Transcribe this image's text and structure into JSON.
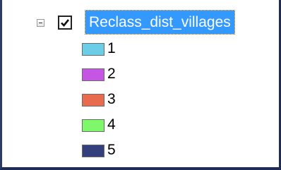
{
  "toc": {
    "layer": {
      "name": "Reclass_dist_villages",
      "checked": true,
      "expanded": true
    },
    "legend": [
      {
        "label": "1",
        "color": "#6ccde6"
      },
      {
        "label": "2",
        "color": "#c456e3"
      },
      {
        "label": "3",
        "color": "#e86a4f"
      },
      {
        "label": "4",
        "color": "#7ff76a"
      },
      {
        "label": "5",
        "color": "#34407e"
      }
    ]
  },
  "icons": {
    "expander": "collapse-minus-icon",
    "visibility": "checkbox-checked-icon"
  }
}
